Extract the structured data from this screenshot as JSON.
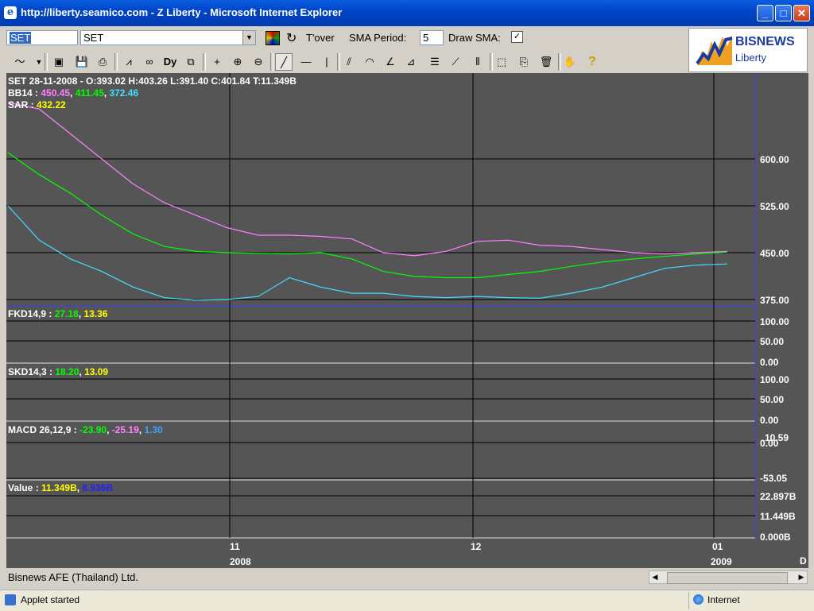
{
  "window": {
    "title": "http://liberty.seamico.com - Z Liberty - Microsoft Internet Explorer",
    "minimize": "_",
    "maximize": "□",
    "close": "✕"
  },
  "toolbar": {
    "symbol_input": "SET",
    "symbol_select": "SET",
    "tover_label": "T'over",
    "sma_label": "SMA Period:",
    "sma_value": "5",
    "draw_sma_label": "Draw SMA:",
    "draw_sma_checked": "✓"
  },
  "logo": {
    "line1": "BISNEWS",
    "line2": "Liberty"
  },
  "chart": {
    "price_header": "SET 28-11-2008 - O:393.02 H:403.26 L:391.40 C:401.84 T:11.349B",
    "bb_label": "BB14 : ",
    "bb_values": [
      "450.45",
      "411.45",
      "372.46"
    ],
    "sar_label": "SAR : ",
    "sar_value": "432.22",
    "price_ticks": [
      "600.00",
      "525.00",
      "450.00",
      "375.00"
    ],
    "fkd_label": "FKD14,9 : ",
    "fkd_values": [
      "27.18",
      "13.36"
    ],
    "skd_label": "SKD14,3 : ",
    "skd_values": [
      "18.20",
      "13.09"
    ],
    "osc_ticks": [
      "100.00",
      "50.00",
      "0.00"
    ],
    "macd_label": "MACD 26,12,9 : ",
    "macd_values": [
      "-23.90",
      "-25.19",
      "1.30"
    ],
    "macd_ticks": [
      "10.59",
      "0.00",
      "-53.05"
    ],
    "value_label": "Value : ",
    "value_values": [
      "11.349B",
      "8.936B"
    ],
    "value_ticks": [
      "22.897B",
      "11.449B",
      "0.000B"
    ],
    "x_months": [
      "11",
      "12",
      "01"
    ],
    "x_years": [
      "2008",
      "2009"
    ],
    "x_unit": "D",
    "colors": {
      "bg": "#555555",
      "up": "#00c800",
      "down": "#ff2020",
      "bb_upper": "#ff80ff",
      "bb_mid": "#00ff00",
      "bb_lower": "#40e0ff",
      "sar": "#ffff00",
      "volume": "#ffff00",
      "grid": "#000000"
    }
  },
  "chart_data": {
    "type": "line",
    "title": "SET",
    "series": [
      {
        "name": "BB14 upper",
        "values": [
          690,
          680,
          640,
          600,
          560,
          530,
          510,
          490,
          478,
          478,
          476,
          472,
          450,
          445,
          452,
          468,
          470,
          462,
          460,
          455,
          450,
          448,
          450,
          452
        ]
      },
      {
        "name": "BB14 middle",
        "values": [
          610,
          575,
          545,
          510,
          480,
          460,
          452,
          450,
          449,
          448,
          450,
          440,
          420,
          412,
          410,
          410,
          415,
          420,
          428,
          435,
          440,
          444,
          448,
          451
        ]
      },
      {
        "name": "BB14 lower",
        "values": [
          525,
          470,
          440,
          420,
          395,
          378,
          374,
          375,
          380,
          410,
          395,
          385,
          385,
          380,
          378,
          380,
          378,
          377,
          385,
          395,
          410,
          425,
          430,
          432
        ]
      }
    ],
    "ylim": [
      360,
      700
    ]
  },
  "footer": {
    "company": "Bisnews AFE (Thailand) Ltd.",
    "status": "Applet started",
    "zone": "Internet"
  }
}
